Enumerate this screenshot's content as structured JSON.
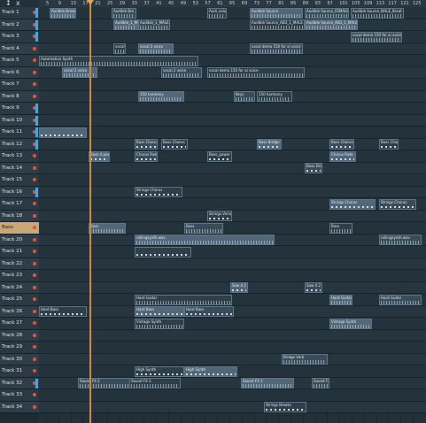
{
  "ruler": {
    "bars": [
      "5",
      "9",
      "13",
      "17",
      "21",
      "25",
      "29",
      "33",
      "37",
      "41",
      "45",
      "49",
      "53",
      "57",
      "61",
      "65",
      "69",
      "73",
      "77",
      "81",
      "85",
      "89",
      "93",
      "97",
      "101",
      "105",
      "109",
      "113",
      "117",
      "121",
      "125"
    ],
    "close_glyph": "x",
    "tool_glyph": "↕"
  },
  "tracks": [
    {
      "label": "Track 1"
    },
    {
      "label": "Track 2"
    },
    {
      "label": "Track 3"
    },
    {
      "label": "Track 4"
    },
    {
      "label": "Track 5"
    },
    {
      "label": "Track 6"
    },
    {
      "label": "Track 7"
    },
    {
      "label": "Track 8"
    },
    {
      "label": "Track 9"
    },
    {
      "label": "Track 10"
    },
    {
      "label": "Track 11"
    },
    {
      "label": "Track 12"
    },
    {
      "label": "Track 13"
    },
    {
      "label": "Track 14"
    },
    {
      "label": "Track 15"
    },
    {
      "label": "Track 16"
    },
    {
      "label": "Track 17"
    },
    {
      "label": "Track 18"
    },
    {
      "label": "Bass",
      "active": true
    },
    {
      "label": "Track 20"
    },
    {
      "label": "Track 21"
    },
    {
      "label": "Track 22"
    },
    {
      "label": "Track 23"
    },
    {
      "label": "Track 24"
    },
    {
      "label": "Track 25"
    },
    {
      "label": "Track 26"
    },
    {
      "label": "Track 27"
    },
    {
      "label": "Track 28"
    },
    {
      "label": "Track 29"
    },
    {
      "label": "Track 30"
    },
    {
      "label": "Track 31"
    },
    {
      "label": "Track 32"
    },
    {
      "label": "Track 33"
    },
    {
      "label": "Track 34"
    }
  ],
  "clips": [
    {
      "track": 0,
      "label": "Audible Breath",
      "kind": "wave"
    },
    {
      "track": 0,
      "label": "Audible Bre",
      "kind": "wave"
    },
    {
      "track": 0,
      "label": "Audi_volu",
      "kind": "wave"
    },
    {
      "track": 0,
      "label": "Audible Source",
      "kind": "wave"
    },
    {
      "track": 0,
      "label": "Audible Source_FEMALE",
      "kind": "wave"
    },
    {
      "track": 0,
      "label": "Audible Source_MALE_Breat",
      "kind": "wave"
    },
    {
      "track": 1,
      "label": "Audible_1_MALE",
      "kind": "wave"
    },
    {
      "track": 1,
      "label": "Audible_1_MALE",
      "kind": "wave"
    },
    {
      "track": 1,
      "label": "Audible Source_AED_1_MALE",
      "kind": "wave"
    },
    {
      "track": 1,
      "label": "Audible Source_AED_1_MALE",
      "kind": "wave"
    },
    {
      "track": 2,
      "label": "vocal demo 150 for ai voice",
      "kind": "wave"
    },
    {
      "track": 3,
      "label": "vocal 1",
      "kind": "wave"
    },
    {
      "track": 3,
      "label": "vocal 2 voice",
      "kind": "wave"
    },
    {
      "track": 3,
      "label": "vocal demo 150 for ai voice",
      "kind": "wave"
    },
    {
      "track": 4,
      "label": "Automation Synth",
      "kind": "wave"
    },
    {
      "track": 5,
      "label": "vocal 2 voice",
      "kind": "wave"
    },
    {
      "track": 5,
      "label": "vocal 2 voice",
      "kind": "wave"
    },
    {
      "track": 5,
      "label": "vocal demo 150 for ai voice",
      "kind": "wave"
    },
    {
      "track": 7,
      "label": "150 harmony",
      "kind": "wave"
    },
    {
      "track": 7,
      "label": "Keys",
      "kind": "wave"
    },
    {
      "track": 7,
      "label": "150 harmony",
      "kind": "wave"
    },
    {
      "track": 10,
      "label": "",
      "kind": "notes"
    },
    {
      "track": 11,
      "label": "Bass Chorus",
      "kind": "notes"
    },
    {
      "track": 11,
      "label": "Bass Chorus",
      "kind": "notes"
    },
    {
      "track": 11,
      "label": "Bass Bridge",
      "kind": "notes"
    },
    {
      "track": 11,
      "label": "Bass Chorus",
      "kind": "notes"
    },
    {
      "track": 11,
      "label": "Bass Chorus",
      "kind": "notes"
    },
    {
      "track": 12,
      "label": "Bass 4 power",
      "kind": "notes"
    },
    {
      "track": 12,
      "label": "Chorus Pads",
      "kind": "notes"
    },
    {
      "track": 12,
      "label": "Bass_power",
      "kind": "notes"
    },
    {
      "track": 12,
      "label": "Chorus Pads",
      "kind": "notes"
    },
    {
      "track": 13,
      "label": "Bass Drop",
      "kind": "notes"
    },
    {
      "track": 15,
      "label": "Strings Chorus",
      "kind": "notes"
    },
    {
      "track": 16,
      "label": "Strings Chorus",
      "kind": "notes"
    },
    {
      "track": 16,
      "label": "Strings Chorus",
      "kind": "notes"
    },
    {
      "track": 17,
      "label": "Strings Verse",
      "kind": "notes"
    },
    {
      "track": 18,
      "label": "Bass",
      "kind": "wave"
    },
    {
      "track": 18,
      "label": "Bass",
      "kind": "wave"
    },
    {
      "track": 18,
      "label": "Bass",
      "kind": "wave"
    },
    {
      "track": 19,
      "label": "rollingsynth.wav",
      "kind": "wave"
    },
    {
      "track": 19,
      "label": "rollingsynth.wav",
      "kind": "wave"
    },
    {
      "track": 20,
      "label": "",
      "kind": "notes"
    },
    {
      "track": 23,
      "label": "Saw 4 2",
      "kind": "notes"
    },
    {
      "track": 23,
      "label": "Saw 4 2",
      "kind": "notes"
    },
    {
      "track": 24,
      "label": "Hard Guitar",
      "kind": "wave"
    },
    {
      "track": 24,
      "label": "Hard Guitar",
      "kind": "wave"
    },
    {
      "track": 24,
      "label": "Hard Guitar",
      "kind": "wave"
    },
    {
      "track": 25,
      "label": "Hard Bass",
      "kind": "notes"
    },
    {
      "track": 25,
      "label": "Hard Bass",
      "kind": "notes"
    },
    {
      "track": 25,
      "label": "Hard Bass",
      "kind": "notes"
    },
    {
      "track": 26,
      "label": "Vintage Synth",
      "kind": "wave"
    },
    {
      "track": 26,
      "label": "Vintage Synth",
      "kind": "wave"
    },
    {
      "track": 29,
      "label": "Bridge Verb",
      "kind": "wave"
    },
    {
      "track": 30,
      "label": "High Synth",
      "kind": "notes"
    },
    {
      "track": 30,
      "label": "High Synth",
      "kind": "notes"
    },
    {
      "track": 31,
      "label": "Sound FX 2",
      "kind": "wave"
    },
    {
      "track": 31,
      "label": "Sound FX 2",
      "kind": "wave"
    },
    {
      "track": 31,
      "label": "Sound FX 2",
      "kind": "wave"
    },
    {
      "track": 31,
      "label": "Sound FX 2",
      "kind": "wave"
    },
    {
      "track": 33,
      "label": "Strings Breaks",
      "kind": "notes"
    }
  ],
  "colors": {
    "playhead": "#d38a2f",
    "active_track": "#c9a779",
    "mute_dot": "#e0573a"
  }
}
